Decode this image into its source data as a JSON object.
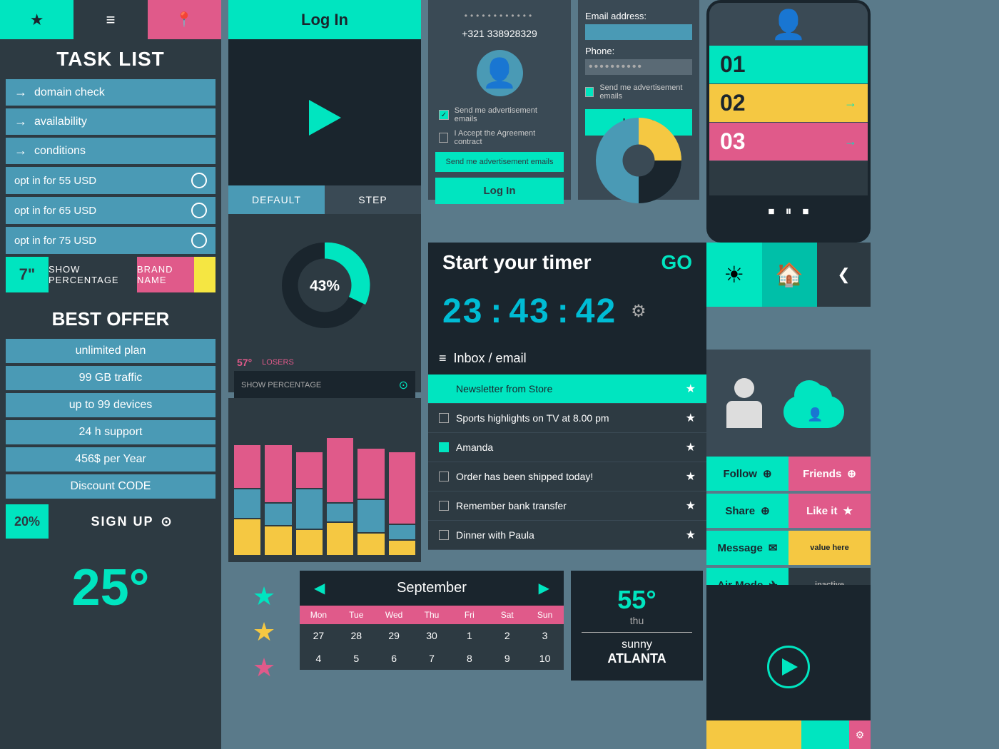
{
  "left": {
    "top_bar": {
      "star": "★",
      "menu": "≡",
      "pin": "📍"
    },
    "task_list": {
      "title": "TASK LIST",
      "items": [
        {
          "label": "domain check",
          "type": "arrow"
        },
        {
          "label": "availability",
          "type": "arrow"
        },
        {
          "label": "conditions",
          "type": "arrow"
        },
        {
          "label": "opt in for 55 USD",
          "type": "radio"
        },
        {
          "label": "opt in for 65 USD",
          "type": "radio"
        },
        {
          "label": "opt in for 75 USD",
          "type": "radio"
        }
      ],
      "size": "7\"",
      "show_percentage": "SHOW PERCENTAGE",
      "brand_name": "BRAND NAME"
    },
    "best_offer": {
      "title": "BEST OFFER",
      "items": [
        "unlimited plan",
        "99 GB traffic",
        "up to 99 devices",
        "24 h support",
        "456$ per Year",
        "Discount CODE"
      ],
      "discount_pct": "20%",
      "signup": "SIGN UP",
      "temp": "25°"
    }
  },
  "middle_top": {
    "login_btn": "Log In",
    "dots": "••••••••••••",
    "phone": "+321 338928329",
    "checkbox1": "Send me advertisement emails",
    "checkbox2": "I Accept the Agreement contract",
    "adv_btn": "Send me advertisement emails",
    "login_btn2": "Log In"
  },
  "form": {
    "email_label": "Email address:",
    "phone_label": "Phone:",
    "dots": "••••••••••",
    "adv_checkbox": "Send me advertisement emails",
    "login_btn": "Log In"
  },
  "stepper": {
    "tab1": "DEFAULT",
    "tab2": "STEP",
    "percent": "43%",
    "degree": "57°",
    "losers": "LOSERS",
    "show_percentage": "SHOW PERCENTAGE"
  },
  "timer": {
    "title": "Start your timer",
    "go": "GO",
    "hours": "23",
    "minutes": "43",
    "seconds": "42",
    "colon": ":"
  },
  "inbox": {
    "title": "Inbox / email",
    "items": [
      {
        "label": "Newsletter from Store",
        "checked": true,
        "highlighted": true
      },
      {
        "label": "Sports highlights on TV at 8.00 pm",
        "checked": false,
        "highlighted": false
      },
      {
        "label": "Amanda",
        "checked": true,
        "highlighted": false
      },
      {
        "label": "Order has been shipped today!",
        "checked": false,
        "highlighted": false
      },
      {
        "label": "Remember bank transfer",
        "checked": false,
        "highlighted": false
      },
      {
        "label": "Dinner with Paula",
        "checked": false,
        "highlighted": false
      }
    ]
  },
  "phone_widget": {
    "nums": [
      "01",
      "02",
      "03"
    ],
    "arrows": [
      "→",
      "→",
      "→"
    ]
  },
  "social": {
    "follow": "Follow",
    "friends": "Friends",
    "share": "Share",
    "like": "Like it",
    "message": "Message",
    "air_mode": "Air Mode"
  },
  "calendar": {
    "month": "September",
    "days_header": [
      "Mon",
      "Tue",
      "Wed",
      "Thu",
      "Fri",
      "Sat",
      "Sun"
    ],
    "days": [
      "27",
      "28",
      "29",
      "30",
      "1",
      "2",
      "3",
      "4",
      "5",
      "6",
      "7",
      "8",
      "9",
      "10"
    ]
  },
  "weather": {
    "temp": "55°",
    "day": "thu",
    "desc": "sunny",
    "city": "ATLANTA"
  },
  "stars": [
    "★",
    "★",
    "★"
  ],
  "bottom_right": {
    "play": "▶"
  },
  "colors": {
    "teal": "#00e5c0",
    "pink": "#e05a8a",
    "yellow": "#f5c842",
    "dark": "#1a252d",
    "mid": "#2d3a42",
    "blue": "#4a9ab5"
  }
}
